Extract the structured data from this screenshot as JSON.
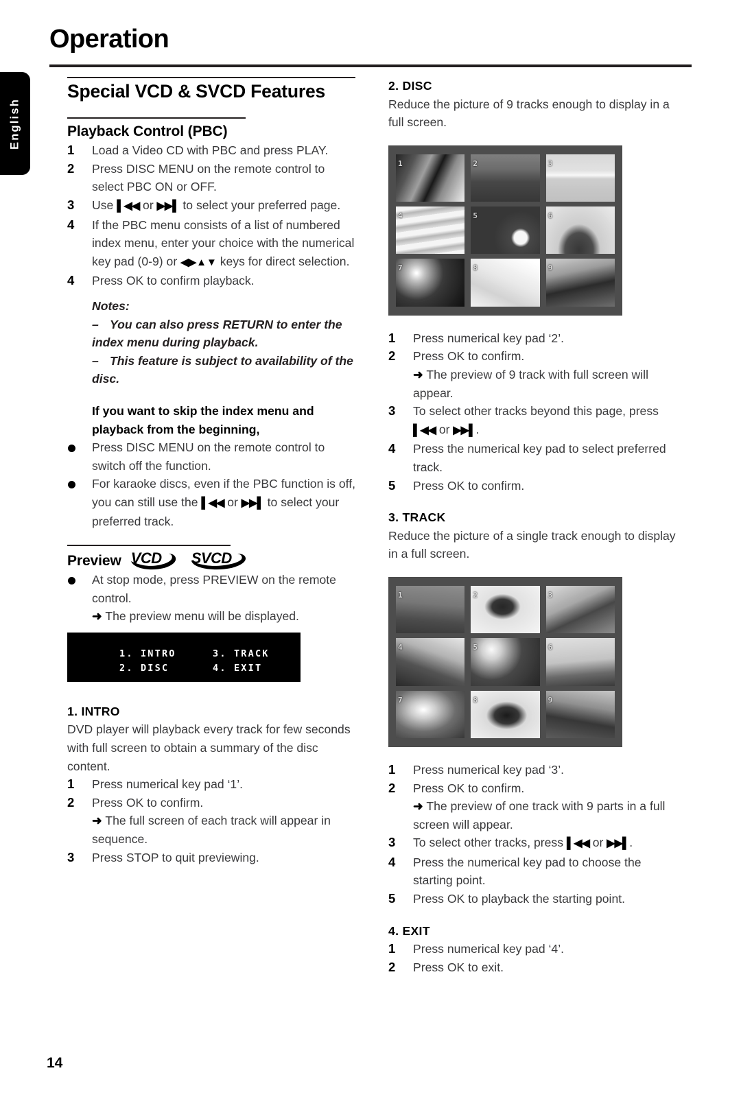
{
  "page": {
    "chapter_title": "Operation",
    "language_tab": "English",
    "page_number": "14"
  },
  "left_column": {
    "section_heading": "Special VCD & SVCD Features",
    "pbc": {
      "heading": "Playback Control (PBC)",
      "steps": [
        {
          "num": "1",
          "text": "Load a Video CD with PBC and press PLAY."
        },
        {
          "num": "2",
          "text": "Press DISC MENU on the remote control to select PBC ON or OFF."
        },
        {
          "num": "3",
          "text_before": "Use ",
          "key1": "skip-back",
          "text_mid": " or ",
          "key2": "skip-forward",
          "text_after": " to select your preferred page."
        },
        {
          "num": "4",
          "text_before": "If the PBC menu consists of a list of numbered index menu, enter your choice with the numerical key pad (0-9) or ",
          "arrowkeys": "direction-keys",
          "text_after": " keys for direct selection."
        },
        {
          "num": "4",
          "text": "Press OK to confirm playback."
        }
      ],
      "notes_label": "Notes:",
      "notes": [
        "You can also press RETURN to enter the index menu during playback.",
        "This feature is subject to availability of the disc."
      ]
    },
    "skip_index": {
      "heading": "If you want to skip the index menu and playback from the beginning,",
      "bullets": [
        {
          "text": "Press DISC MENU on the remote control to switch off the function."
        },
        {
          "text_before": "For karaoke discs, even if the PBC function is off, you can still use the ",
          "key1": "skip-back",
          "text_mid": " or ",
          "key2": "skip-forward",
          "text_after": " to select your preferred track."
        }
      ]
    },
    "preview": {
      "heading": "Preview",
      "logos": [
        "VCD",
        "SVCD"
      ],
      "bullet": "At stop mode, press PREVIEW on the remote control.",
      "arrow_note": "The preview menu will be displayed.",
      "osd_menu": [
        {
          "left": "1. INTRO",
          "right": "3. TRACK"
        },
        {
          "left": "2. DISC",
          "right": "4. EXIT"
        }
      ]
    },
    "intro": {
      "heading": "1. INTRO",
      "body": "DVD player will playback every track for few seconds with full screen to obtain a summary of the disc content.",
      "steps": [
        {
          "num": "1",
          "text": "Press numerical key pad ‘1’."
        },
        {
          "num": "2",
          "text": "Press OK to confirm."
        }
      ],
      "arrow_note": "The full screen of each track will appear in sequence.",
      "final_step": {
        "num": "3",
        "text": "Press STOP to quit previewing."
      }
    }
  },
  "right_column": {
    "disc": {
      "heading": "2. DISC",
      "body": "Reduce the picture of 9 tracks enough to display in a full screen.",
      "screenshot_numbers": [
        "1",
        "2",
        "3",
        "4",
        "5",
        "6",
        "7",
        "8",
        "9"
      ],
      "steps": [
        {
          "num": "1",
          "text": "Press numerical key pad ‘2’."
        },
        {
          "num": "2",
          "text": "Press OK to confirm."
        }
      ],
      "arrow_note": "The preview of 9 track with full screen will appear.",
      "steps_after": [
        {
          "num": "3",
          "text_before": "To select other tracks beyond this page, press ",
          "key1": "skip-back",
          "text_mid": " or ",
          "key2": "skip-forward",
          "text_after": "."
        },
        {
          "num": "4",
          "text": "Press the numerical key pad to select preferred track."
        },
        {
          "num": "5",
          "text": "Press OK to confirm."
        }
      ]
    },
    "track": {
      "heading": "3. TRACK",
      "body": "Reduce the picture of a single track enough to display in a full screen.",
      "screenshot_numbers": [
        "1",
        "2",
        "3",
        "4",
        "5",
        "6",
        "7",
        "8",
        "9"
      ],
      "steps": [
        {
          "num": "1",
          "text": "Press numerical key pad ‘3’."
        },
        {
          "num": "2",
          "text": "Press OK to confirm."
        }
      ],
      "arrow_note": "The preview of one track with 9 parts in a full screen will appear.",
      "steps_after": [
        {
          "num": "3",
          "text_before": "To select other tracks, press ",
          "key1": "skip-back",
          "text_mid": " or ",
          "key2": "skip-forward",
          "text_after": "."
        },
        {
          "num": "4",
          "text": "Press the numerical key pad to choose the starting point."
        },
        {
          "num": "5",
          "text": "Press OK to playback the starting point."
        }
      ]
    },
    "exit": {
      "heading": "4. EXIT",
      "steps": [
        {
          "num": "1",
          "text": "Press numerical key pad ‘4’."
        },
        {
          "num": "2",
          "text": "Press OK to exit."
        }
      ]
    }
  },
  "glyphs": {
    "skip_back": "⏪",
    "skip_forward": "⏩",
    "arrow": "➜",
    "dash": "–"
  }
}
